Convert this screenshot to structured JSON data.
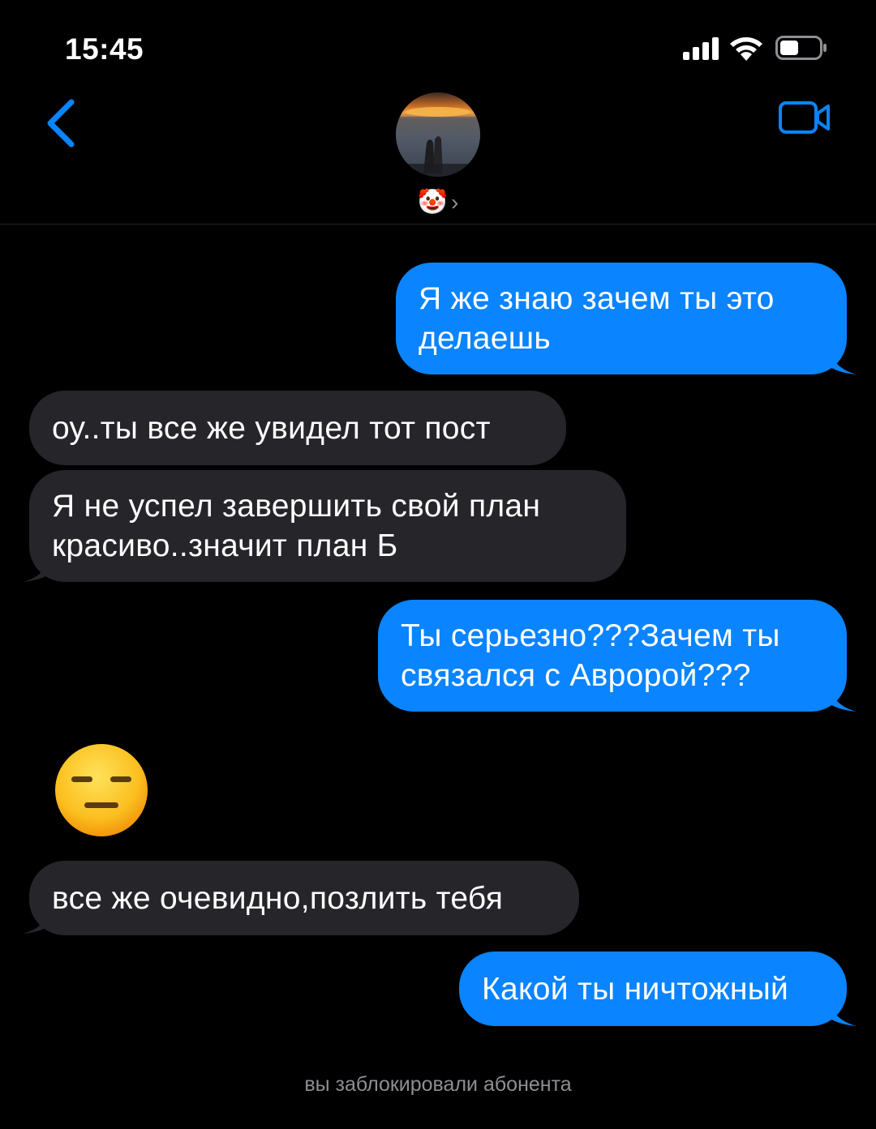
{
  "status_bar": {
    "time": "15:45",
    "icons": [
      "signal-icon",
      "wifi-icon",
      "battery-icon"
    ]
  },
  "header": {
    "back_icon": "chevron-left-icon",
    "contact_name": "🤡",
    "contact_chevron": "›",
    "video_icon": "video-camera-icon"
  },
  "messages": [
    {
      "direction": "outgoing",
      "text": "Я же знаю зачем ты это\nделаешь"
    },
    {
      "direction": "incoming",
      "text": "оу..ты все же увидел тот пост"
    },
    {
      "direction": "incoming",
      "text": "Я не успел завершить свой план\nкрасиво..значит план Б"
    },
    {
      "direction": "outgoing",
      "text": "Ты серьезно???Зачем ты\nсвязался с Авророй???"
    },
    {
      "direction": "incoming",
      "type": "emoji",
      "text": "expressionless-face-emoji"
    },
    {
      "direction": "incoming",
      "text": "все же очевидно,позлить тебя"
    },
    {
      "direction": "outgoing",
      "text": "Какой ты ничтожный"
    }
  ],
  "footer": {
    "blocked_note": "вы заблокировали абонента"
  },
  "colors": {
    "background": "#000000",
    "outgoing_bubble": "#0a84ff",
    "incoming_bubble": "#26252a",
    "accent": "#0a84ff",
    "secondary_text": "#8e8e93"
  }
}
